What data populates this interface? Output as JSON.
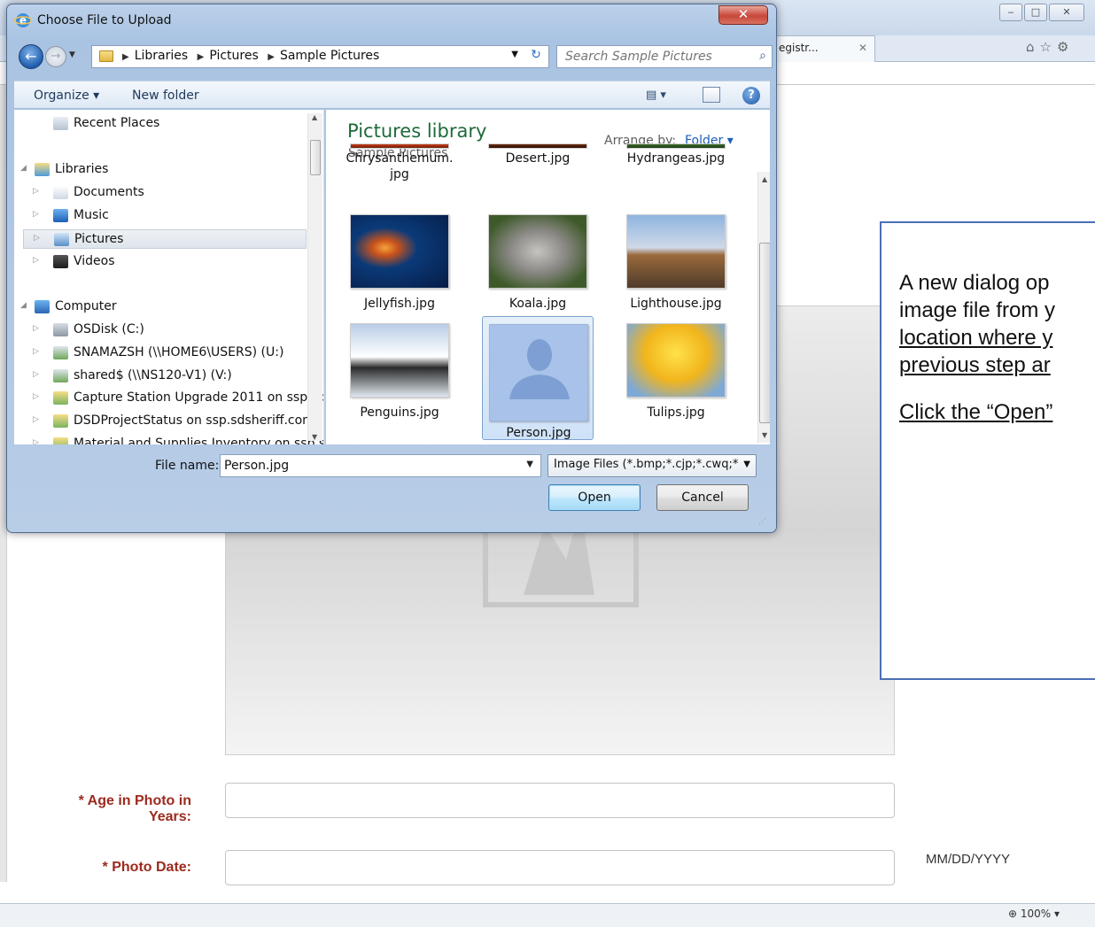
{
  "browser": {
    "tab_label": "egistr...",
    "tab_close": "✕",
    "toolbar_icons": [
      "home-icon",
      "star-icon",
      "gear-icon"
    ],
    "window_buttons": [
      "minimize",
      "maximize",
      "close"
    ],
    "zoom": "100%"
  },
  "callout": {
    "lines": [
      "A new dialog op",
      "image file from y",
      "location where y",
      "previous step ar",
      "Click the “Open”"
    ]
  },
  "form": {
    "age_label_line1": "* Age in Photo in",
    "age_label_line2": "Years:",
    "age_value": "",
    "date_label": "* Photo Date:",
    "date_value": "",
    "date_hint": "MM/DD/YYYY"
  },
  "dialog": {
    "title": "Choose File to Upload",
    "close_label": "✕",
    "breadcrumb": [
      "Libraries",
      "Pictures",
      "Sample Pictures"
    ],
    "search_placeholder": "Search Sample Pictures",
    "organize_label": "Organize ▾",
    "new_folder_label": "New folder",
    "nav_items": [
      {
        "label": "Recent Places",
        "icon": "recent-places-icon",
        "depth": 1,
        "twisty": ""
      },
      {
        "label": "Libraries",
        "icon": "libraries-icon",
        "depth": 0,
        "twisty": "◢"
      },
      {
        "label": "Documents",
        "icon": "documents-icon",
        "depth": 1,
        "twisty": "▷"
      },
      {
        "label": "Music",
        "icon": "music-icon",
        "depth": 1,
        "twisty": "▷"
      },
      {
        "label": "Pictures",
        "icon": "pictures-icon",
        "depth": 1,
        "twisty": "▷",
        "selected": true
      },
      {
        "label": "Videos",
        "icon": "videos-icon",
        "depth": 1,
        "twisty": "▷"
      },
      {
        "label": "Computer",
        "icon": "computer-icon",
        "depth": 0,
        "twisty": "◢"
      },
      {
        "label": "OSDisk (C:)",
        "icon": "disk-icon",
        "depth": 1,
        "twisty": "▷"
      },
      {
        "label": "SNAMAZSH (\\\\HOME6\\USERS) (U:)",
        "icon": "network-drive-icon",
        "depth": 1,
        "twisty": "▷"
      },
      {
        "label": "shared$ (\\\\NS120-V1) (V:)",
        "icon": "network-drive-icon",
        "depth": 1,
        "twisty": "▷"
      },
      {
        "label": "Capture Station Upgrade 2011 on ssp.sds",
        "icon": "network-folder-icon",
        "depth": 1,
        "twisty": "▷"
      },
      {
        "label": "DSDProjectStatus on ssp.sdsheriff.com",
        "icon": "network-folder-icon",
        "depth": 1,
        "twisty": "▷"
      },
      {
        "label": "Material and Supplies Inventory on ssp.s",
        "icon": "network-folder-icon",
        "depth": 1,
        "twisty": "▷"
      }
    ],
    "library_title": "Pictures library",
    "library_subtitle": "Sample Pictures",
    "arrange_label": "Arrange by:",
    "arrange_value": "Folder ▾",
    "files": [
      {
        "name": "Chrysanthemum.",
        "name2": "jpg",
        "thumb": "chrysanthemum"
      },
      {
        "name": "Desert.jpg",
        "name2": "",
        "thumb": "desert"
      },
      {
        "name": "Hydrangeas.jpg",
        "name2": "",
        "thumb": "hydrangeas"
      },
      {
        "name": "Jellyfish.jpg",
        "name2": "",
        "thumb": "jellyfish"
      },
      {
        "name": "Koala.jpg",
        "name2": "",
        "thumb": "koala"
      },
      {
        "name": "Lighthouse.jpg",
        "name2": "",
        "thumb": "lighthouse"
      },
      {
        "name": "Penguins.jpg",
        "name2": "",
        "thumb": "penguins"
      },
      {
        "name": "Person.jpg",
        "name2": "",
        "thumb": "person",
        "selected": true
      },
      {
        "name": "Tulips.jpg",
        "name2": "",
        "thumb": "tulips"
      }
    ],
    "file_name_label": "File name:",
    "file_name_value": "Person.jpg",
    "filter_value": "Image Files (*.bmp;*.cjp;*.cwq;*",
    "open_label": "Open",
    "cancel_label": "Cancel"
  }
}
